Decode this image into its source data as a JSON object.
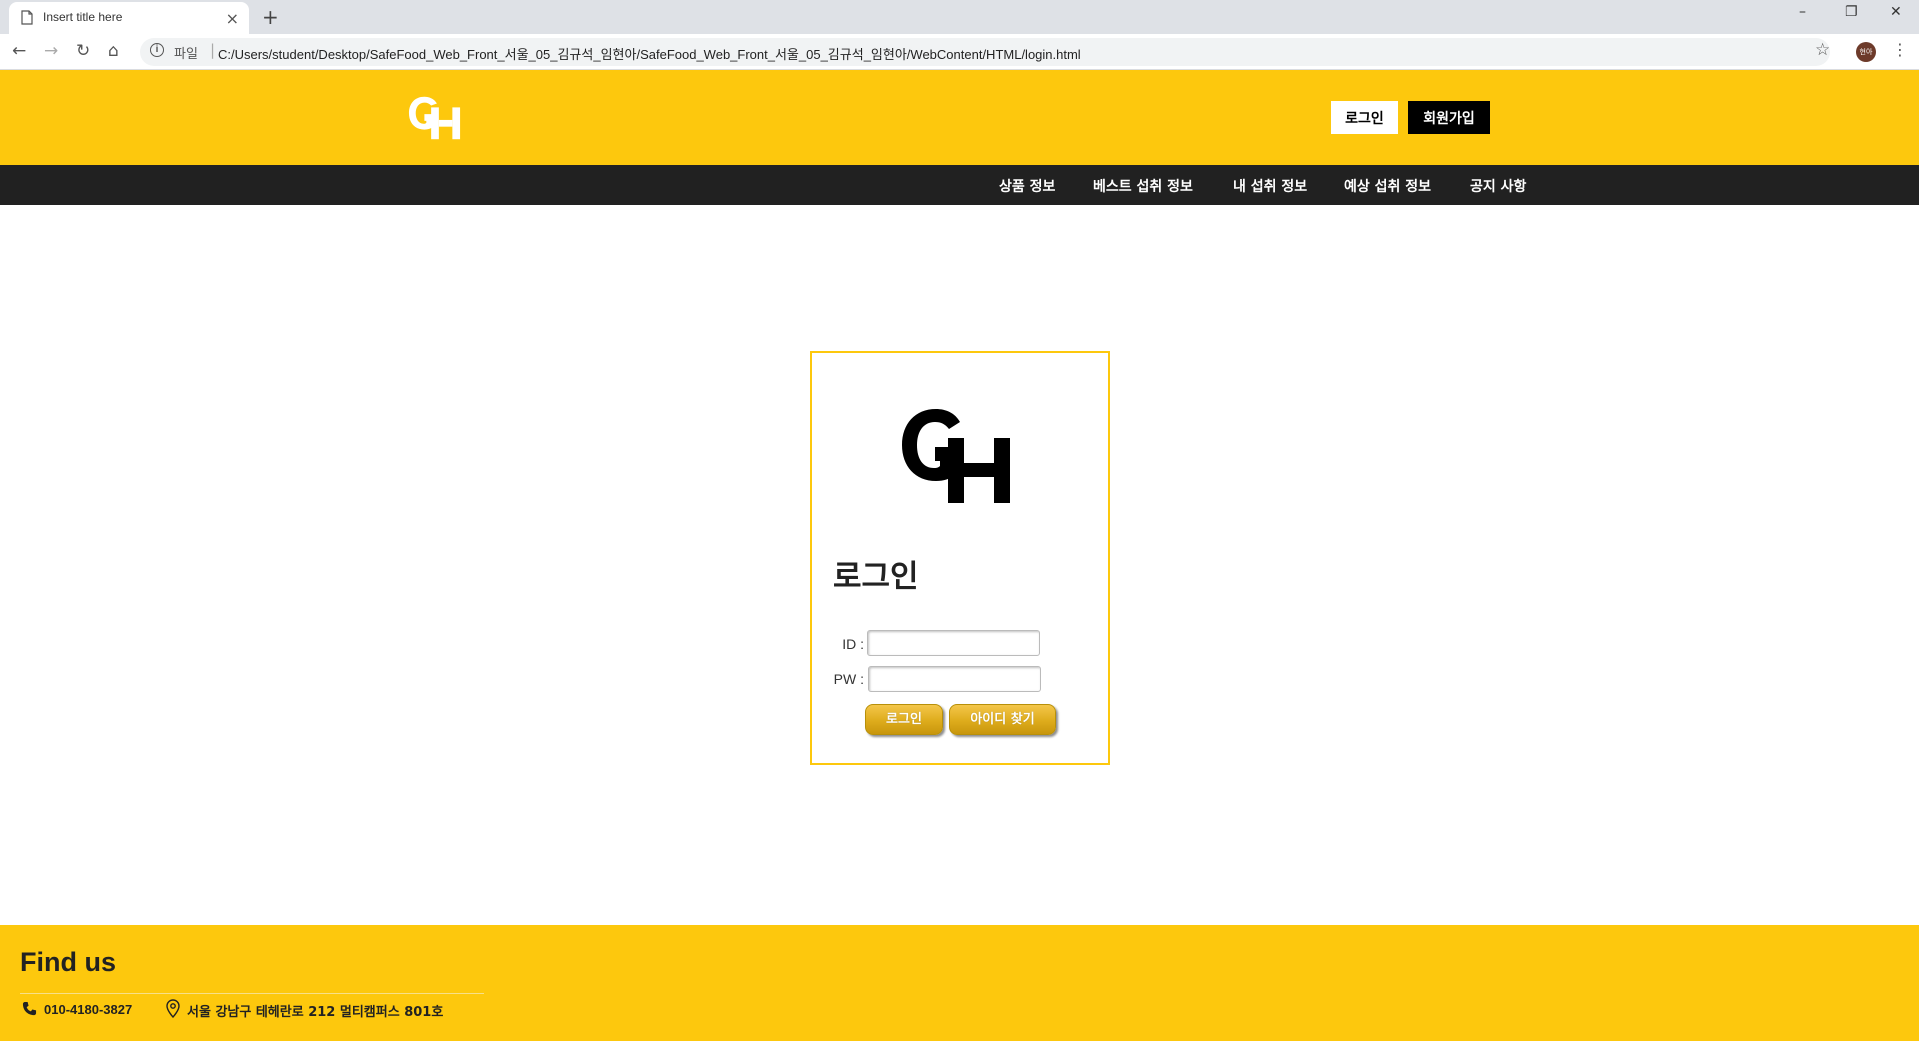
{
  "browser": {
    "tab_title": "Insert title here",
    "tab_close": "×",
    "new_tab": "+",
    "window_controls": [
      "–",
      "❐",
      "✕"
    ],
    "nav": {
      "back": "←",
      "forward": "→",
      "reload": "↻",
      "home": "⌂"
    },
    "scheme_label": "파일",
    "url": "C:/Users/student/Desktop/SafeFood_Web_Front_서울_05_김규석_임현아/SafeFood_Web_Front_서울_05_김규석_임현아/WebContent/HTML/login.html",
    "profile_initials": "현아",
    "menu": "⋮",
    "star": "☆"
  },
  "header": {
    "login_button": "로그인",
    "signup_button": "회원가입",
    "brand_color": "#fdc80d"
  },
  "nav": {
    "items": [
      "상품 정보",
      "베스트 섭취 정보",
      "내 섭취 정보",
      "예상 섭취 정보",
      "공지 사항"
    ]
  },
  "login": {
    "title": "로그인",
    "id_label": "ID :",
    "pw_label": "PW :",
    "id_value": "",
    "pw_value": "",
    "login_button": "로그인",
    "find_id_button": "아이디 찾기"
  },
  "footer": {
    "title": "Find us",
    "phone": "010-4180-3827",
    "address": "서울 강남구 테헤란로 212 멀티캠퍼스 801호"
  }
}
